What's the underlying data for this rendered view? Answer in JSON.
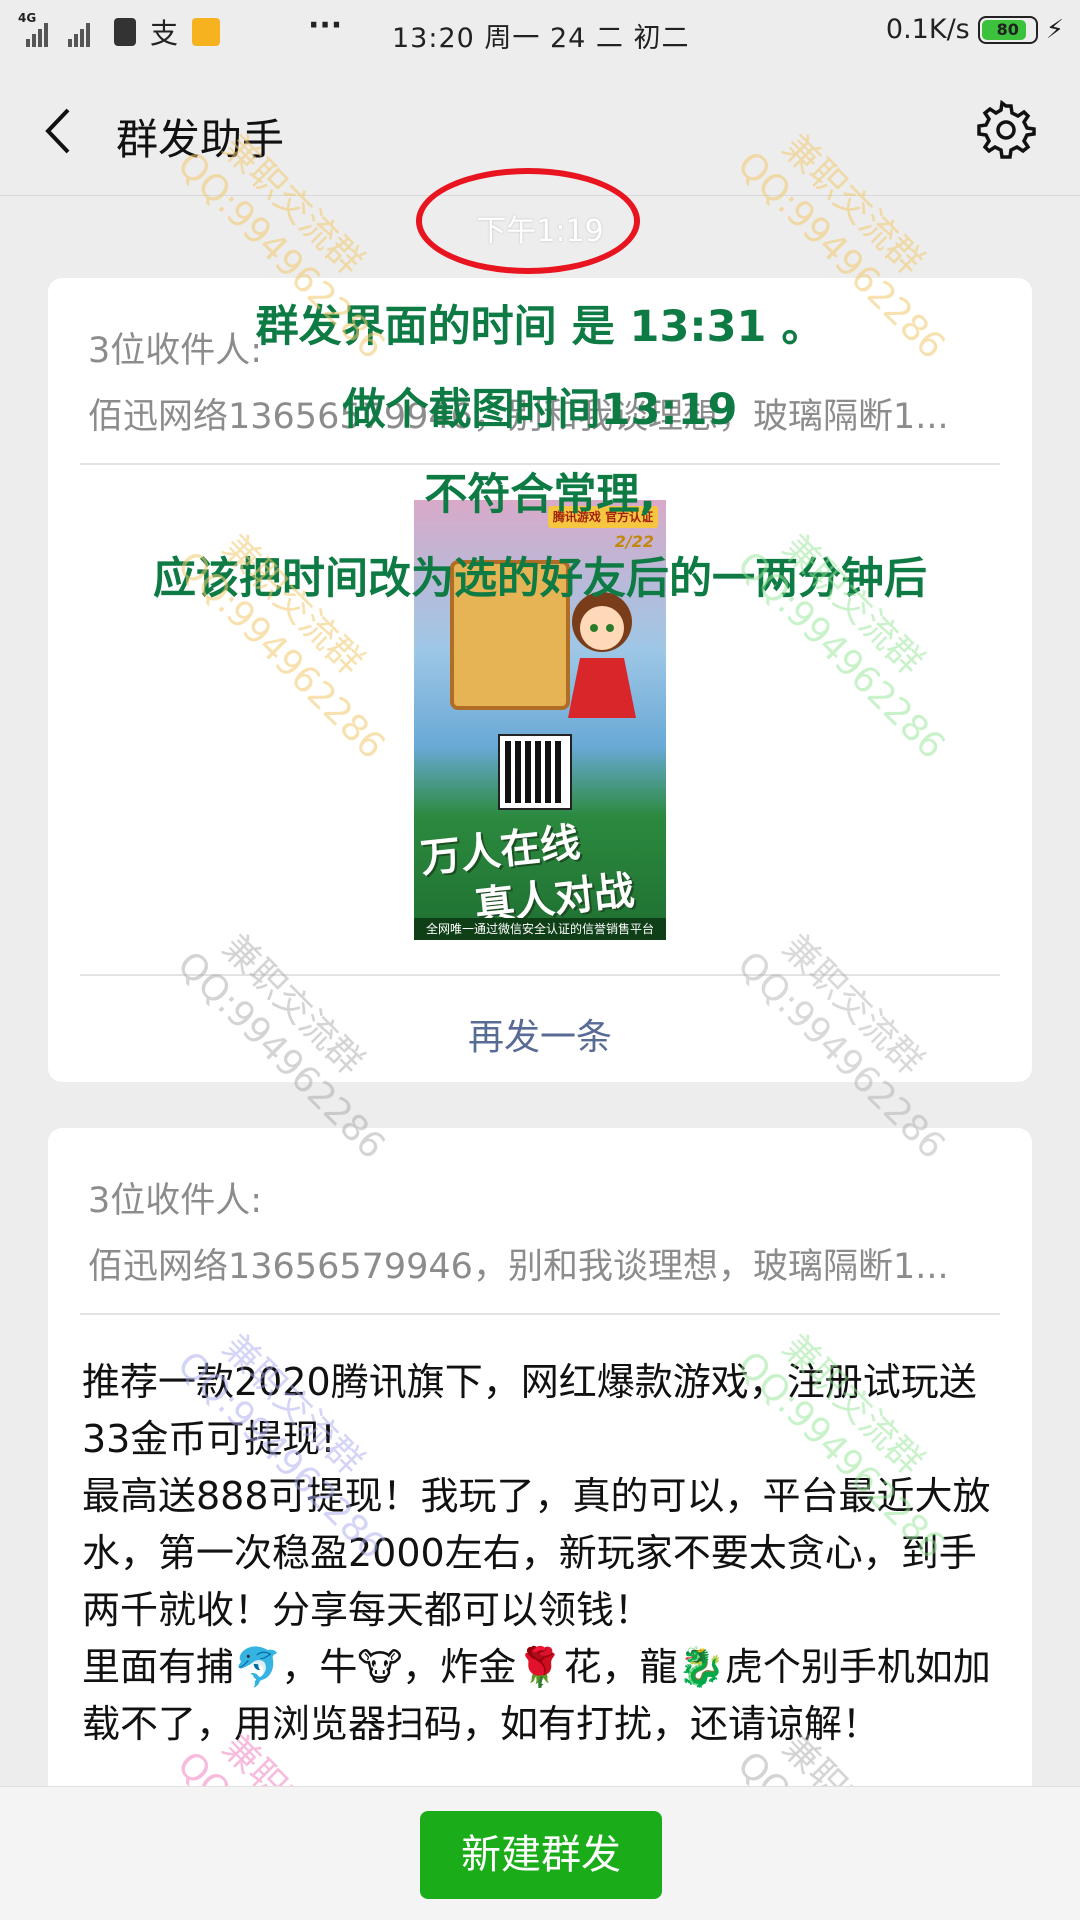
{
  "status_bar": {
    "network": "4G",
    "pay_glyph": "支",
    "dots": "···",
    "time_date": "13:20 周一 24 二 初二",
    "speed": "0.1K/s",
    "battery": "80"
  },
  "nav": {
    "title": "群发助手",
    "back_icon": "back-chevron-icon",
    "settings_icon": "gear-icon"
  },
  "time_chip": "下午1:19",
  "annotation": {
    "line1": "群发界面的时间 是 13:31 。",
    "line2": "做个截图时间13:19",
    "line3": "不符合常理,",
    "line4": "应该把时间改为选的好友后的一两分钟后",
    "ring_color": "#e8141f",
    "text_color": "#0e7a44"
  },
  "card1": {
    "recipients_title": "3位收件人:",
    "recipients_list": "佰迅网络13656579946，别和我谈理想，玻璃隔断1...",
    "poster": {
      "brand": "腾讯游戏 官方认证",
      "date": "2/22",
      "slogan_line1": "万人在线",
      "slogan_line2": "真人对战",
      "footer": "全网唯一通过微信安全认证的信誉销售平台"
    },
    "resend_label": "再发一条"
  },
  "card2": {
    "recipients_title": "3位收件人:",
    "recipients_list": "佰迅网络13656579946，别和我谈理想，玻璃隔断1...",
    "message": "推荐一款2020腾讯旗下，网红爆款游戏，注册试玩送33金币可提现!\n最高送888可提现！我玩了，真的可以，平台最近大放水，第一次稳盈2000左右，新玩家不要太贪心，到手两千就收！分享每天都可以领钱！\n里面有捕🐬，牛🐮，炸金🌹花，龍🐉虎个别手机如加载不了，用浏览器扫码，如有打扰，还请谅解！"
  },
  "watermark": {
    "line1": "兼职交流群",
    "line2": "QQ:994962286"
  },
  "bottom": {
    "new_button": "新建群发",
    "accent": "#1aad19"
  }
}
